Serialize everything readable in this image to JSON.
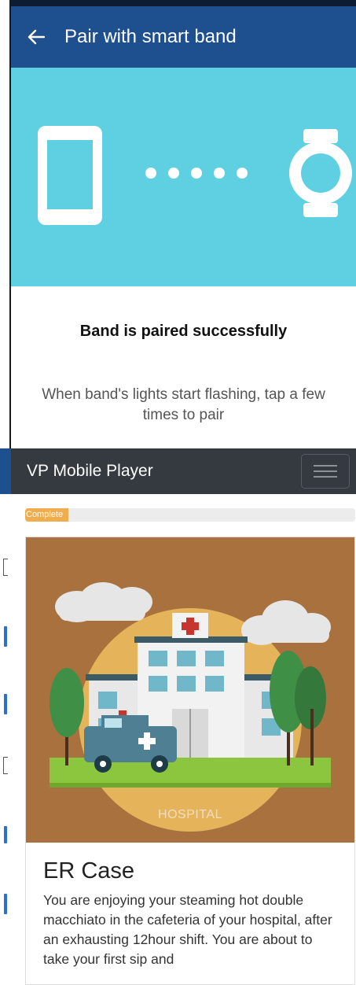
{
  "pair_screen": {
    "header": {
      "back_icon": "arrow-left-icon",
      "title": "Pair with smart band"
    },
    "hero": {
      "phone_icon": "phone-icon",
      "dots_icon": "connection-dots-icon",
      "watch_icon": "watch-icon"
    },
    "status_text": "Band is paired successfully",
    "instruction": "When band's lights start flashing, tap a few times to pair"
  },
  "player": {
    "navbar": {
      "title": "VP Mobile Player",
      "menu_icon": "hamburger-icon"
    },
    "progress": {
      "label": "Complete",
      "fraction": 0.13
    },
    "card": {
      "image_caption": "HOSPITAL",
      "title": "ER Case",
      "text": "You are enjoying your steaming hot double macchiato in the cafeteria of your hospital, after an exhausting 12hour shift. You are about to take your first sip and"
    }
  },
  "colors": {
    "pair_header": "#1e4f8f",
    "hero_bg": "#5fd0e2",
    "navbar_bg": "#343a40",
    "progress_fill": "#f0ad4e",
    "card_image_bg": "#a9713d"
  }
}
